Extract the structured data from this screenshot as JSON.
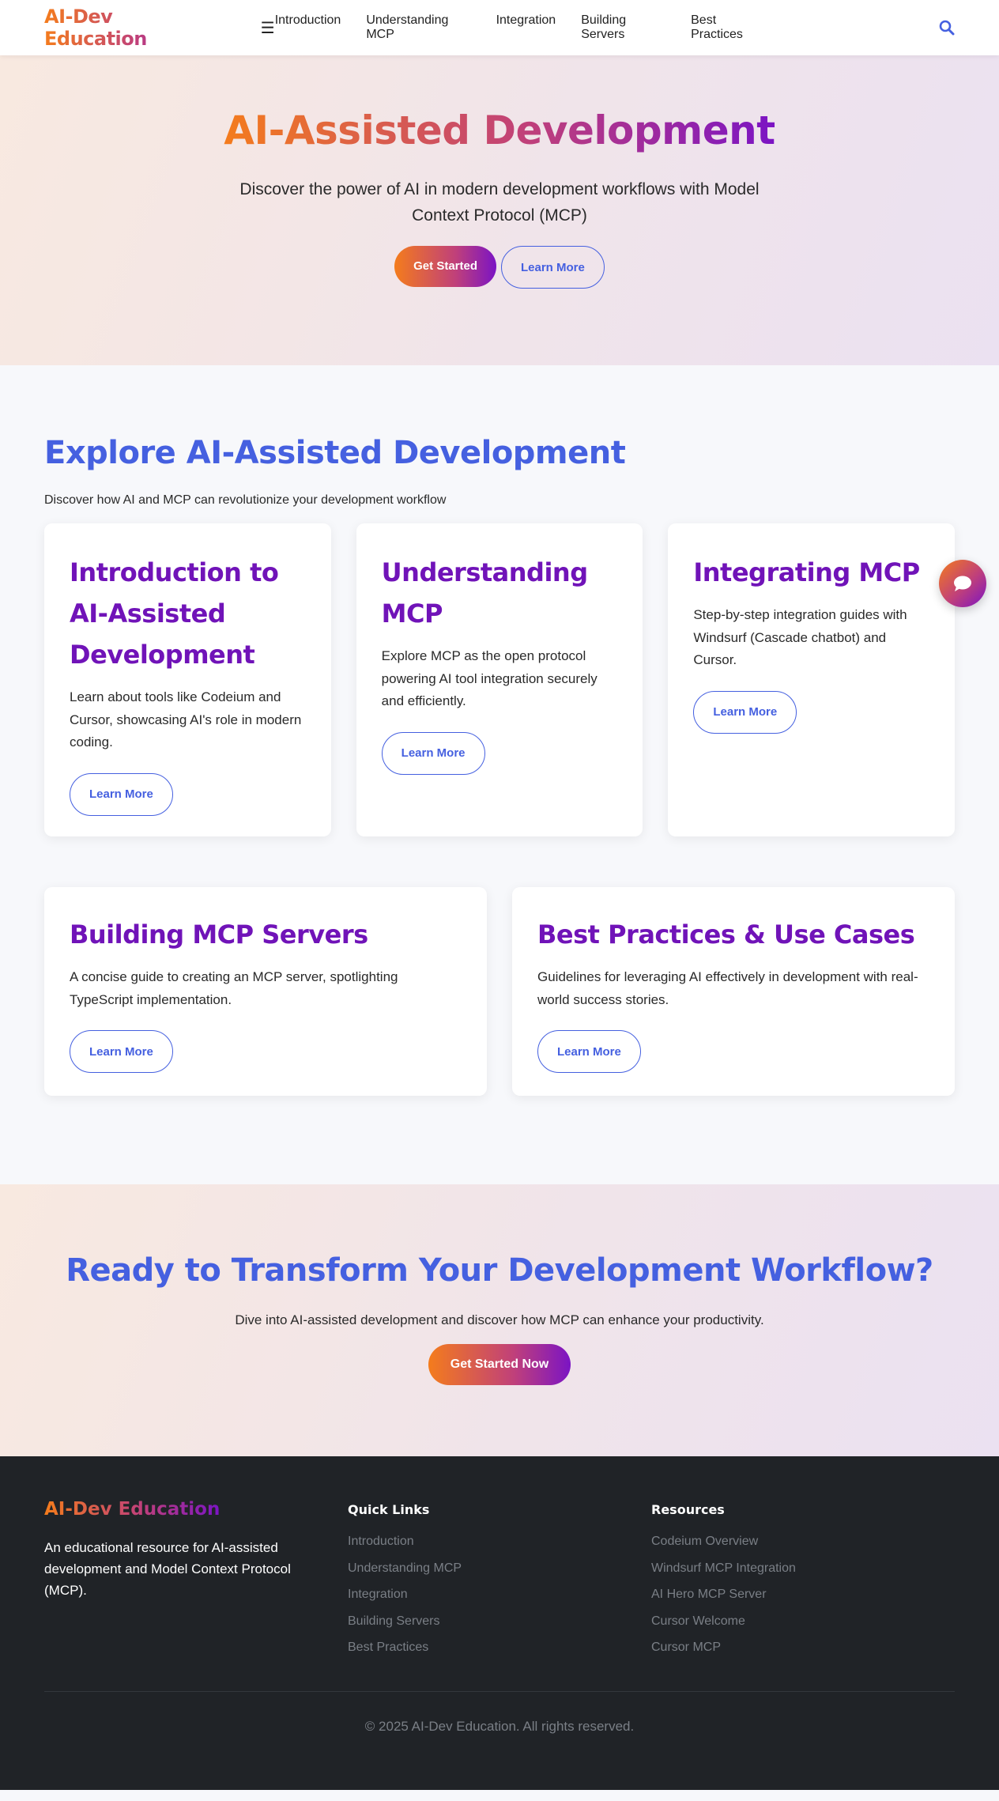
{
  "brand": "AI-Dev Education",
  "nav": {
    "menu_icon": "☰",
    "links": [
      "Introduction",
      "Understanding MCP",
      "Integration",
      "Building Servers",
      "Best Practices"
    ]
  },
  "hero": {
    "title": "AI-Assisted Development",
    "subtitle": "Discover the power of AI in modern development workflows with Model Context Protocol (MCP)",
    "primary_button": "Get Started",
    "secondary_button": "Learn More"
  },
  "explore": {
    "title": "Explore AI-Assisted Development",
    "subtitle": "Discover how AI and MCP can revolutionize your development workflow",
    "cards": [
      {
        "title": "Introduction to AI-Assisted Development",
        "text": "Learn about tools like Codeium and Cursor, showcasing AI's role in modern coding.",
        "button": "Learn More"
      },
      {
        "title": "Understanding MCP",
        "text": "Explore MCP as the open protocol powering AI tool integration securely and efficiently.",
        "button": "Learn More"
      },
      {
        "title": "Integrating MCP",
        "text": "Step-by-step integration guides with Windsurf (Cascade chatbot) and Cursor.",
        "button": "Learn More"
      },
      {
        "title": "Building MCP Servers",
        "text": "A concise guide to creating an MCP server, spotlighting TypeScript implementation.",
        "button": "Learn More"
      },
      {
        "title": "Best Practices & Use Cases",
        "text": "Guidelines for leveraging AI effectively in development with real-world success stories.",
        "button": "Learn More"
      }
    ]
  },
  "cta": {
    "title": "Ready to Transform Your Development Workflow?",
    "subtitle": "Dive into AI-assisted development and discover how MCP can enhance your productivity.",
    "button": "Get Started Now"
  },
  "footer": {
    "brand": "AI-Dev Education",
    "description": "An educational resource for AI-assisted development and Model Context Protocol (MCP).",
    "quick_links_heading": "Quick Links",
    "quick_links": [
      "Introduction",
      "Understanding MCP",
      "Integration",
      "Building Servers",
      "Best Practices"
    ],
    "resources_heading": "Resources",
    "resources": [
      "Codeium Overview",
      "Windsurf MCP Integration",
      "AI Hero MCP Server",
      "Cursor Welcome",
      "Cursor MCP"
    ],
    "copyright": "© 2025 AI-Dev Education. All rights reserved."
  },
  "icons": {
    "search": "search-icon",
    "chat": "chat-bubble-icon",
    "menu": "hamburger-menu-icon"
  },
  "colors": {
    "accent_blue": "#4560e0",
    "card_title_purple": "#7013b8",
    "gradient_start": "#f47c1c",
    "gradient_mid": "#c0407a",
    "gradient_end": "#7b14c4",
    "footer_bg": "#202327"
  }
}
